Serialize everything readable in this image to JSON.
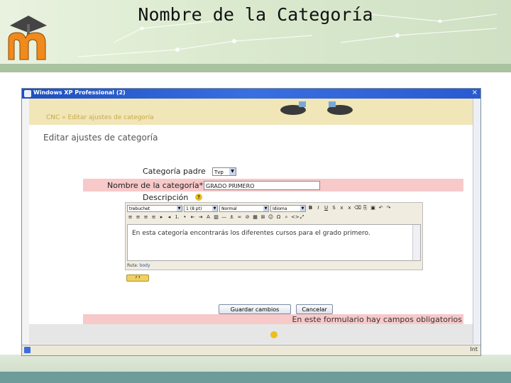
{
  "slide": {
    "title": "Nombre de la Categoría"
  },
  "window": {
    "title": "Windows XP Professional (2)",
    "close": "×"
  },
  "banner": {
    "breadcrumb": "CNC » Editar ajustes de categoría"
  },
  "form": {
    "section_title": "Editar ajustes de categoría",
    "parent_label": "Categoría padre",
    "parent_value": "Tvp",
    "name_label": "Nombre de la categoría*",
    "name_value": "GRADO PRIMERO",
    "description_label": "Descripción",
    "help_glyph": "?"
  },
  "editor": {
    "font_value": "trebuchet",
    "size_value": "1 (8 pt)",
    "style_value": "Normal",
    "lang_value": "Idioma",
    "content": "En esta categoría encontrarás los diferentes cursos para el grado primero.",
    "path_label": "Ruta:",
    "path_value": "body"
  },
  "buttons": {
    "save": "Guardar cambios",
    "cancel": "Cancelar"
  },
  "notice": {
    "required": "En este formulario hay campos obligatorios"
  },
  "statusbar": {
    "right_text": "Int"
  },
  "colors": {
    "required_bg": "#f7c9c9",
    "banner_bg": "#f1e6b7",
    "titlebar": "#2a5ad0",
    "logo_orange": "#f08a1c"
  }
}
